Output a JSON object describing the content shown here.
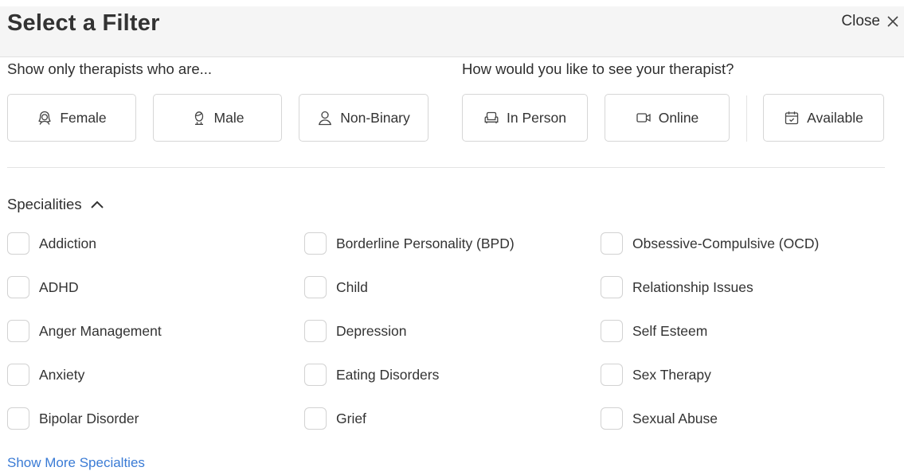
{
  "header": {
    "title": "Select a Filter",
    "close_label": "Close"
  },
  "gender": {
    "heading": "Show only therapists who are...",
    "options": [
      {
        "label": "Female",
        "icon": "female-icon"
      },
      {
        "label": "Male",
        "icon": "male-icon"
      },
      {
        "label": "Non-Binary",
        "icon": "person-icon"
      }
    ]
  },
  "format": {
    "heading": "How would you like to see your therapist?",
    "options": [
      {
        "label": "In Person",
        "icon": "couch-icon"
      },
      {
        "label": "Online",
        "icon": "video-icon"
      },
      {
        "label": "Available",
        "icon": "calendar-icon"
      }
    ]
  },
  "specialities": {
    "heading": "Specialities",
    "items": [
      "Addiction",
      "ADHD",
      "Anger Management",
      "Anxiety",
      "Bipolar Disorder",
      "Borderline Personality (BPD)",
      "Child",
      "Depression",
      "Eating Disorders",
      "Grief",
      "Obsessive-Compulsive (OCD)",
      "Relationship Issues",
      "Self Esteem",
      "Sex Therapy",
      "Sexual Abuse"
    ],
    "show_more": "Show More Specialties"
  },
  "colors": {
    "link": "#3a7bd5",
    "header_bg": "#f5f5f5",
    "border": "#d6d6d6"
  }
}
